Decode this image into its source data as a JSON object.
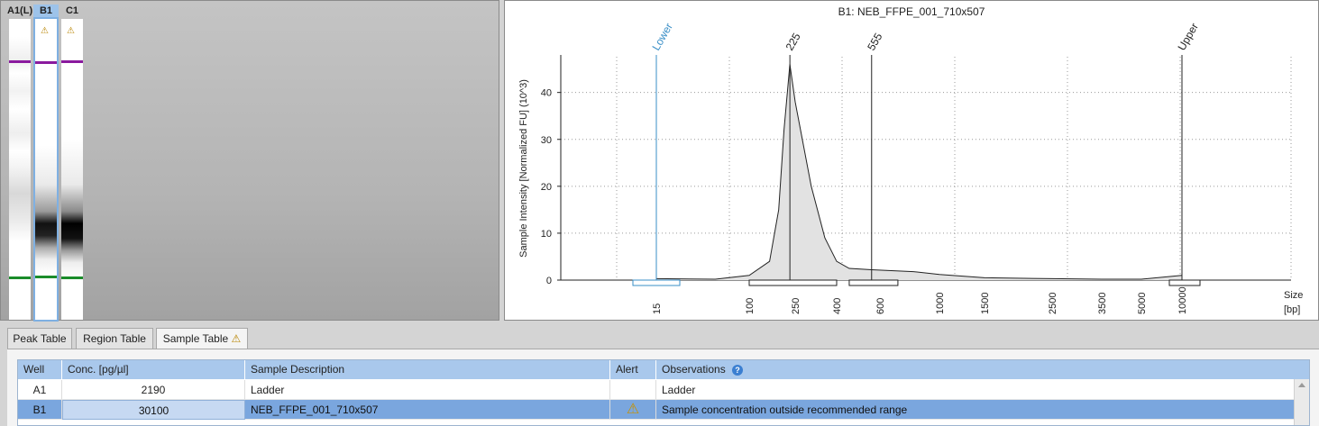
{
  "gel": {
    "lanes": [
      {
        "label": "A1(L)",
        "selected": false,
        "warning": false
      },
      {
        "label": "B1",
        "selected": true,
        "warning": true
      },
      {
        "label": "C1",
        "selected": false,
        "warning": true
      }
    ],
    "warning_glyph": "⚠",
    "colors": {
      "upper_marker": "#8a1a9e",
      "lower_marker": "#1a8c2a"
    }
  },
  "chart": {
    "title": "B1: NEB_FFPE_001_710x507",
    "ylabel": "Sample Intensity [Normalized FU] (10^3)",
    "xlabel_line1": "Size",
    "xlabel_line2": "[bp]"
  },
  "chart_data": {
    "type": "area",
    "title": "B1: NEB_FFPE_001_710x507",
    "ylabel": "Sample Intensity [Normalized FU] (10^3)",
    "xlabel": "Size [bp]",
    "ylim": [
      0,
      48
    ],
    "yticks": [
      0,
      10,
      20,
      30,
      40
    ],
    "xticks": [
      "15",
      "100",
      "250",
      "400",
      "600",
      "1000",
      "1500",
      "2500",
      "3500",
      "5000",
      "10000"
    ],
    "peak_labels": [
      "Lower",
      "225",
      "555",
      "Upper"
    ],
    "peaks": [
      {
        "label": "Lower",
        "size_bp": 15,
        "height": 0.6
      },
      {
        "label": "225",
        "size_bp": 225,
        "height": 46
      },
      {
        "label": "555",
        "size_bp": 555,
        "height": 2.2
      },
      {
        "label": "Upper",
        "size_bp": 10000,
        "height": 1.0
      }
    ],
    "trace": [
      [
        15,
        0.3
      ],
      [
        50,
        0.2
      ],
      [
        100,
        1.0
      ],
      [
        150,
        4
      ],
      [
        180,
        15
      ],
      [
        200,
        32
      ],
      [
        225,
        46
      ],
      [
        250,
        38
      ],
      [
        300,
        20
      ],
      [
        350,
        9
      ],
      [
        400,
        4
      ],
      [
        450,
        2.5
      ],
      [
        555,
        2.2
      ],
      [
        800,
        1.8
      ],
      [
        1000,
        1.2
      ],
      [
        1500,
        0.5
      ],
      [
        2500,
        0.3
      ],
      [
        3500,
        0.2
      ],
      [
        5000,
        0.2
      ],
      [
        10000,
        1.0
      ]
    ],
    "grid": true,
    "colors": {
      "fill": "#e2e2e2",
      "line": "#222222",
      "lower_marker": "#3a8fc7"
    }
  },
  "tabs": [
    {
      "label": "Peak Table",
      "active": false
    },
    {
      "label": "Region Table",
      "active": false
    },
    {
      "label": "Sample Table",
      "active": true,
      "warning": true
    }
  ],
  "table": {
    "headers": [
      "Well",
      "Conc. [pg/µl]",
      "Sample Description",
      "Alert",
      "Observations"
    ],
    "info_glyph": "?",
    "rows": [
      {
        "well": "A1",
        "conc": "2190",
        "description": "Ladder",
        "alert": "",
        "observations": "Ladder",
        "selected": false
      },
      {
        "well": "B1",
        "conc": "30100",
        "description": "NEB_FFPE_001_710x507",
        "alert": "⚠",
        "observations": "Sample concentration outside recommended range",
        "selected": true
      }
    ]
  }
}
